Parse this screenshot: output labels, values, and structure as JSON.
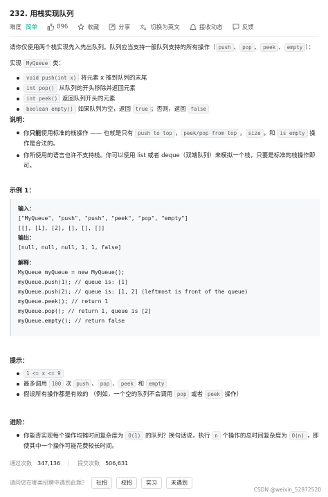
{
  "problem": {
    "title": "232. 用栈实现队列",
    "difficulty_label": "难度",
    "difficulty": "简单",
    "likes": "896",
    "favorite": "收藏",
    "share": "分享",
    "switch_lang": "切换为英文",
    "subscribe": "接收动态",
    "feedback": "反馈"
  },
  "desc": {
    "intro_a": "请你仅使用两个栈实现先入先出队列。队列应当支持一般队列支持的所有操作（",
    "ops": [
      "push",
      "pop",
      "peek",
      "empty"
    ],
    "intro_sep": "、",
    "intro_b": "）：",
    "impl_a": "实现",
    "impl_class": "MyQueue",
    "impl_b": "类：",
    "methods": [
      {
        "code": "void push(int x)",
        "text": "将元素 x 推到队列的末尾"
      },
      {
        "code": "int pop()",
        "text": "从队列的开头移除并返回元素"
      },
      {
        "code": "int peek()",
        "text": "返回队列开头的元素"
      },
      {
        "code": "boolean empty()",
        "text": "如果队列为空，返回",
        "code2": "true",
        "text2": "；否则，返回",
        "code3": "false"
      }
    ]
  },
  "notes": {
    "heading": "说明：",
    "n1_a": "你",
    "n1_bold": "只能",
    "n1_b": "使用标准的栈操作 —— 也就是只有",
    "n1_c1": "push to top",
    "n1_sep1": "，",
    "n1_c2": "peek/pop from top",
    "n1_sep2": "，",
    "n1_c3": "size",
    "n1_sep3": "，和",
    "n1_c4": "is empty",
    "n1_c": "操作是合法的。",
    "n2": "你所使用的语言也许不支持栈。你可以使用 list 或者 deque（双端队列）来模拟一个栈，只要是标准的栈操作即可。"
  },
  "example": {
    "heading": "示例 1：",
    "input_label": "输入：",
    "input_l1": "[\"MyQueue\", \"push\", \"push\", \"peek\", \"pop\", \"empty\"]",
    "input_l2": "[[], [1], [2], [], [], []]",
    "output_label": "输出：",
    "output": "[null, null, null, 1, 1, false]",
    "explain_label": "解释：",
    "explain": [
      "MyQueue myQueue = new MyQueue();",
      "myQueue.push(1); // queue is: [1]",
      "myQueue.push(2); // queue is: [1, 2] (leftmost is front of the queue)",
      "myQueue.peek(); // return 1",
      "myQueue.pop(); // return 1, queue is [2]",
      "myQueue.empty(); // return false"
    ]
  },
  "hints": {
    "heading": "提示：",
    "h1_code": "1 <= x <= 9",
    "h2_a": "最多调用",
    "h2_code": "100",
    "h2_b": "次",
    "h2_c1": "push",
    "h2_sep1": "、",
    "h2_c2": "pop",
    "h2_sep2": "、",
    "h2_c3": "peek",
    "h2_and": "和",
    "h2_c4": "empty",
    "h3_a": "假设所有操作都是有效的 （例如，一个空的队列不会调用",
    "h3_c1": "pop",
    "h3_or": "或者",
    "h3_c2": "peek",
    "h3_b": "操作）"
  },
  "advanced": {
    "heading": "进阶：",
    "a_a": "你能否实现每个操作均摊时间复杂度为",
    "a_c1": "O(1)",
    "a_b": "的队列？换句话说，执行",
    "a_c2": "n",
    "a_c": "个操作的总时间复杂度为",
    "a_c3": "O(n)",
    "a_d": "，即使其中一个操作可能花费较长时间。"
  },
  "stats": {
    "accepted_label": "通过次数",
    "accepted": "347,136",
    "submitted_label": "提交次数",
    "submitted": "506,631"
  },
  "ask": {
    "question": "请问您在哪类招聘中遇到此题？",
    "tags": [
      "社招",
      "校招",
      "实习",
      "未遇到"
    ]
  },
  "watermark": "CSDN @weixin_52872520"
}
